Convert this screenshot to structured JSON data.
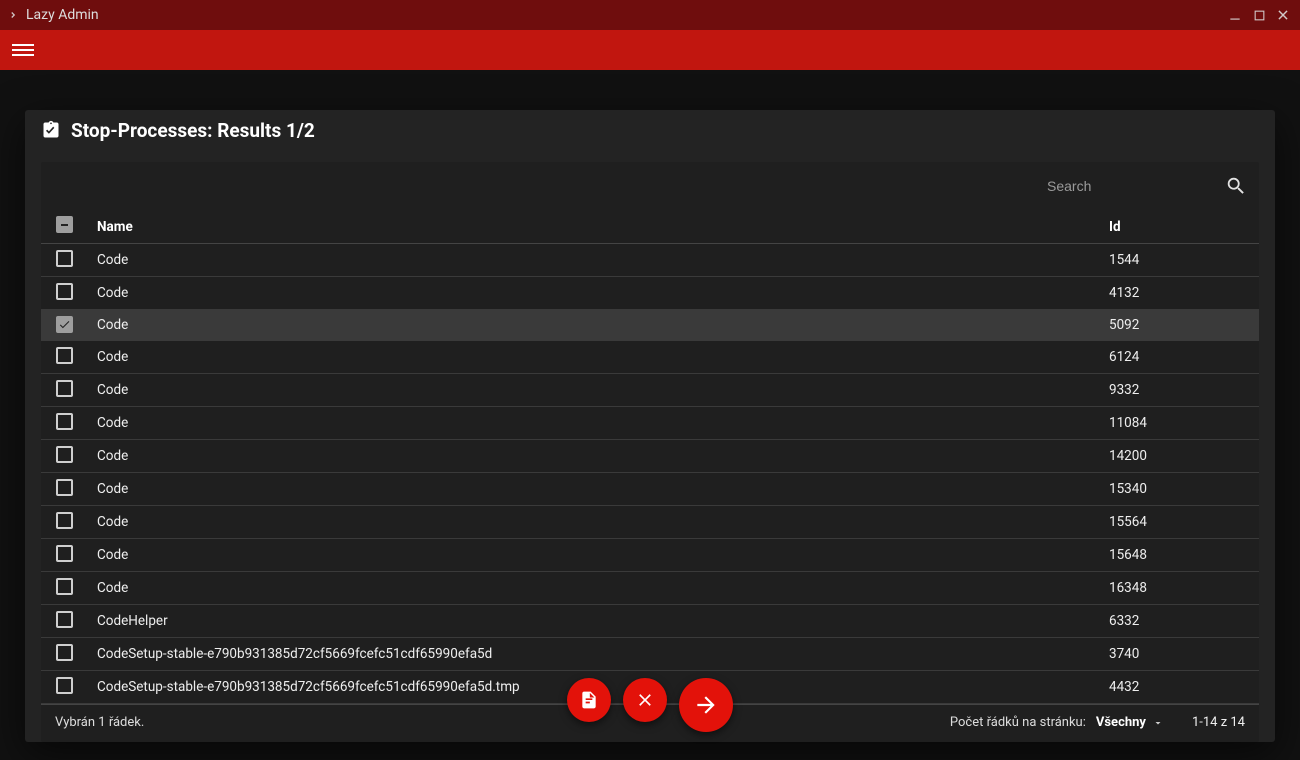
{
  "window": {
    "title": "Lazy Admin"
  },
  "dialog": {
    "title": "Stop-Processes: Results 1/2"
  },
  "search": {
    "placeholder": "Search"
  },
  "columns": {
    "name": "Name",
    "id": "Id"
  },
  "rows": [
    {
      "name": "Code",
      "id": "1544",
      "checked": false
    },
    {
      "name": "Code",
      "id": "4132",
      "checked": false
    },
    {
      "name": "Code",
      "id": "5092",
      "checked": true
    },
    {
      "name": "Code",
      "id": "6124",
      "checked": false
    },
    {
      "name": "Code",
      "id": "9332",
      "checked": false
    },
    {
      "name": "Code",
      "id": "11084",
      "checked": false
    },
    {
      "name": "Code",
      "id": "14200",
      "checked": false
    },
    {
      "name": "Code",
      "id": "15340",
      "checked": false
    },
    {
      "name": "Code",
      "id": "15564",
      "checked": false
    },
    {
      "name": "Code",
      "id": "15648",
      "checked": false
    },
    {
      "name": "Code",
      "id": "16348",
      "checked": false
    },
    {
      "name": "CodeHelper",
      "id": "6332",
      "checked": false
    },
    {
      "name": "CodeSetup-stable-e790b931385d72cf5669fcefc51cdf65990efa5d",
      "id": "3740",
      "checked": false
    },
    {
      "name": "CodeSetup-stable-e790b931385d72cf5669fcefc51cdf65990efa5d.tmp",
      "id": "4432",
      "checked": false
    }
  ],
  "footer": {
    "selected": "Vybrán 1 řádek.",
    "rows_per_page_label": "Počet řádků na stránku:",
    "rows_per_page_value": "Všechny",
    "range": "1-14 z 14"
  },
  "colors": {
    "accent": "#e3120a"
  }
}
